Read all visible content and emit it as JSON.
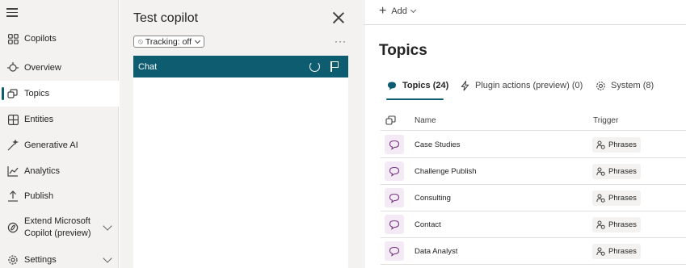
{
  "nav": {
    "items": [
      {
        "label": "Copilots",
        "icon": "grid-icon"
      },
      {
        "label": "Overview",
        "icon": "overview-icon"
      },
      {
        "label": "Topics",
        "icon": "topics-icon",
        "active": true
      },
      {
        "label": "Entities",
        "icon": "entities-icon"
      },
      {
        "label": "Generative AI",
        "icon": "wand-icon"
      },
      {
        "label": "Analytics",
        "icon": "analytics-icon"
      },
      {
        "label": "Publish",
        "icon": "publish-icon"
      },
      {
        "label": "Extend Microsoft Copilot (preview)",
        "icon": "copilot-icon",
        "expandable": true
      },
      {
        "label": "Settings",
        "icon": "gear-icon",
        "expandable": true
      }
    ]
  },
  "test_pane": {
    "title": "Test copilot",
    "tracking_label": "Tracking: off",
    "more_label": "···",
    "chat_title": "Chat"
  },
  "toolbar": {
    "add_label": "Add"
  },
  "main": {
    "title": "Topics",
    "tabs": [
      {
        "label": "Topics (24)",
        "active": true
      },
      {
        "label": "Plugin actions (preview) (0)"
      },
      {
        "label": "System (8)"
      }
    ],
    "table": {
      "columns": {
        "name": "Name",
        "trigger": "Trigger"
      },
      "rows": [
        {
          "name": "Case Studies",
          "trigger": "Phrases"
        },
        {
          "name": "Challenge Publish",
          "trigger": "Phrases"
        },
        {
          "name": "Consulting",
          "trigger": "Phrases"
        },
        {
          "name": "Contact",
          "trigger": "Phrases"
        },
        {
          "name": "Data Analyst",
          "trigger": "Phrases"
        }
      ]
    }
  },
  "colors": {
    "accent": "#0e5c70",
    "nav_bg": "#f3f2f1",
    "topic_icon_bg": "#f3eaf5",
    "topic_icon_fg": "#7a3b83"
  }
}
